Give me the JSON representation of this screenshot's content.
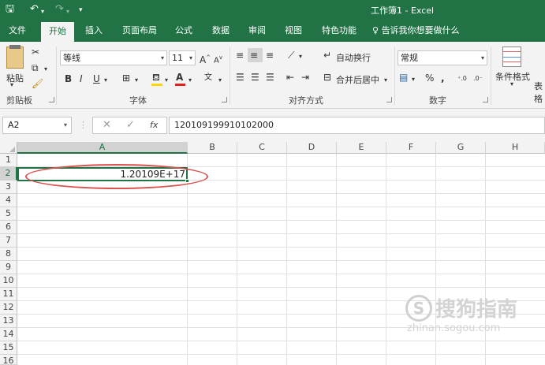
{
  "window": {
    "title": "工作簿1 - Excel"
  },
  "tabs": [
    {
      "label": "文件",
      "active": false
    },
    {
      "label": "开始",
      "active": true
    },
    {
      "label": "插入",
      "active": false
    },
    {
      "label": "页面布局",
      "active": false
    },
    {
      "label": "公式",
      "active": false
    },
    {
      "label": "数据",
      "active": false
    },
    {
      "label": "审阅",
      "active": false
    },
    {
      "label": "视图",
      "active": false
    },
    {
      "label": "特色功能",
      "active": false
    }
  ],
  "tell_me": {
    "label": "告诉我你想要做什么"
  },
  "ribbon": {
    "clipboard": {
      "label": "剪贴板",
      "paste_label": "粘贴"
    },
    "font": {
      "label": "字体",
      "font_name": "等线",
      "font_size": "11"
    },
    "alignment": {
      "label": "对齐方式",
      "wrap_text": "自动换行",
      "merge_center": "合并后居中"
    },
    "number": {
      "label": "数字",
      "format": "常规"
    },
    "styles": {
      "conditional_format": "条件格式",
      "table_format_partial": "表格"
    }
  },
  "formula_bar": {
    "name_box": "A2",
    "formula": "120109199910102000",
    "fx": "fx"
  },
  "columns": [
    "A",
    "B",
    "C",
    "D",
    "E",
    "F",
    "G",
    "H"
  ],
  "rows": [
    "1",
    "2",
    "3",
    "4",
    "5",
    "6",
    "7",
    "8",
    "9",
    "10",
    "11",
    "12",
    "13",
    "14",
    "15",
    "16"
  ],
  "active_cell": {
    "ref": "A2",
    "display_value": "1.20109E+17"
  },
  "watermark": {
    "text_cn": "搜狗指南",
    "text_en": "zhinan.sogou.com"
  },
  "colors": {
    "brand": "#217346",
    "highlight_ellipse": "#d9534f"
  }
}
